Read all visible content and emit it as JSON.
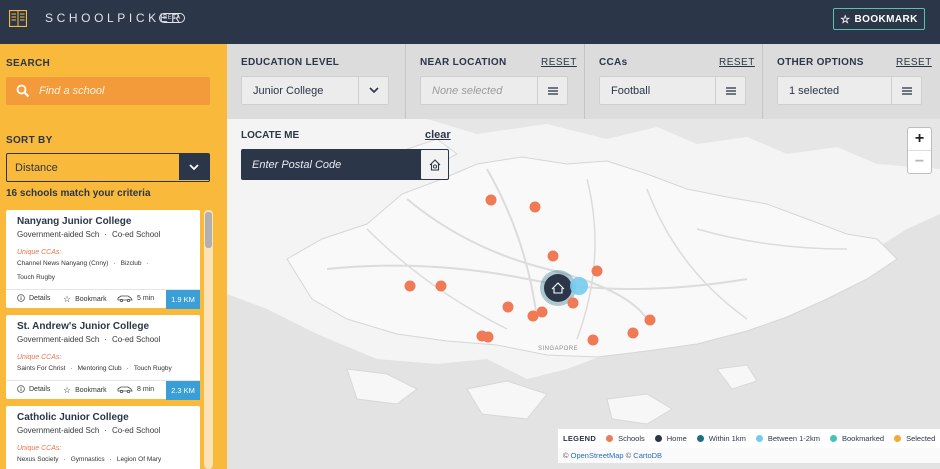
{
  "header": {
    "logo": "SCHOOLPICKER",
    "badge": "BETA",
    "bookmark_label": "BOOKMARK",
    "colors": {
      "background": "#2b3648",
      "accent": "#5dbfae"
    }
  },
  "sidebar": {
    "search_label": "SEARCH",
    "search_placeholder": "Find a school",
    "sort_label": "SORT BY",
    "sort_value": "Distance",
    "match_text": "16 schools match your criteria",
    "unique_ccas_label": "Unique CCAs:",
    "details_label": "Details",
    "bookmark_label": "Bookmark",
    "schools": [
      {
        "name": "Nanyang Junior College",
        "type": "Government-aided Sch",
        "gender": "Co-ed School",
        "ccas": [
          "Channel News Nanyang (Cnny)",
          "Bizclub",
          "Touch Rugby"
        ],
        "drive_time": "5 min",
        "distance": "1.9 KM"
      },
      {
        "name": "St. Andrew's Junior College",
        "type": "Government-aided Sch",
        "gender": "Co-ed School",
        "ccas": [
          "Saints For Christ",
          "Mentoring Club",
          "Touch Rugby"
        ],
        "drive_time": "8 min",
        "distance": "2.3 KM"
      },
      {
        "name": "Catholic Junior College",
        "type": "Government-aided Sch",
        "gender": "Co-ed School",
        "ccas": [
          "Nexus Society",
          "Gymnastics",
          "Legion Of Mary"
        ]
      }
    ],
    "colors": {
      "background": "#f9b93a",
      "search": "#f39a3b",
      "distance_badge": "#3a9fd6"
    }
  },
  "filters": {
    "reset_label": "RESET",
    "education_level": {
      "title": "EDUCATION LEVEL",
      "value": "Junior College"
    },
    "near_location": {
      "title": "NEAR LOCATION",
      "placeholder": "None selected"
    },
    "ccas": {
      "title": "CCAs",
      "value": "Football"
    },
    "other_options": {
      "title": "OTHER OPTIONS",
      "value": "1 selected"
    }
  },
  "map": {
    "locate_label": "LOCATE ME",
    "clear_label": "clear",
    "postal_placeholder": "Enter Postal Code",
    "zoom_in": "+",
    "zoom_out": "−",
    "place_label": "SINGAPORE",
    "legend": {
      "title": "LEGEND",
      "items": [
        {
          "label": "Schools",
          "color": "#ef7a55"
        },
        {
          "label": "Home",
          "color": "#2b3648"
        },
        {
          "label": "Within 1km",
          "color": "#1f6d80"
        },
        {
          "label": "Between 1-2km",
          "color": "#75cbef"
        },
        {
          "label": "Bookmarked",
          "color": "#45c3b8"
        },
        {
          "label": "Selected",
          "color": "#f6a93b"
        }
      ]
    },
    "attribution": {
      "symbol": "©",
      "osm": "OpenStreetMap",
      "carto": "CartoDB"
    }
  }
}
